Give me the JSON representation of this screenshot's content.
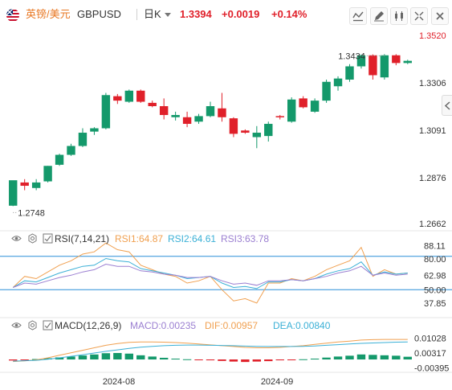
{
  "header": {
    "symbol_name": "英镑/美元",
    "symbol_code": "GBPUSD",
    "period": "日K",
    "last_price": "1.3394",
    "change": "+0.0019",
    "change_pct": "+0.14%"
  },
  "toolbar": {
    "icons": [
      "compare-icon",
      "draw-icon",
      "indicator-icon",
      "fullscreen-icon",
      "close-icon"
    ]
  },
  "price_axis": {
    "labels": [
      "1.3520",
      "1.3306",
      "1.3091",
      "1.2876",
      "1.2662"
    ],
    "high_label": "1.3434",
    "low_label": "1.2748"
  },
  "time_axis": {
    "labels": [
      "2024-08",
      "2024-09"
    ]
  },
  "rsi": {
    "title": "RSI(7,14,21)",
    "rsi1": "RSI1:64.87",
    "rsi2": "RSI2:64.61",
    "rsi3": "RSI3:63.78",
    "axis_labels": [
      "88.11",
      "80.00",
      "62.98",
      "50.00",
      "37.85"
    ]
  },
  "macd": {
    "title": "MACD(12,26,9)",
    "macd": "MACD:0.00235",
    "dif": "DIF:0.00957",
    "dea": "DEA:0.00840",
    "axis_labels": [
      "0.01028",
      "0.00317",
      "-0.00395"
    ]
  },
  "colors": {
    "up": "#e0202a",
    "down": "#14996b",
    "accent": "#e87722",
    "rsi1": "#f0a050",
    "rsi2": "#3bb0d6",
    "rsi3": "#9b7fd1",
    "dif": "#f0a050",
    "dea": "#3bb0d6",
    "ref_line": "#2a8fd8"
  },
  "chart_data": {
    "type": "candlestick",
    "ylim": [
      1.2662,
      1.352
    ],
    "candles": [
      {
        "o": 1.275,
        "h": 1.28,
        "l": 1.2748,
        "c": 1.2865,
        "dir": "down"
      },
      {
        "o": 1.284,
        "h": 1.287,
        "l": 1.282,
        "c": 1.2855,
        "dir": "up"
      },
      {
        "o": 1.2855,
        "h": 1.287,
        "l": 1.282,
        "c": 1.283,
        "dir": "down"
      },
      {
        "o": 1.286,
        "h": 1.293,
        "l": 1.2855,
        "c": 1.293,
        "dir": "down"
      },
      {
        "o": 1.2935,
        "h": 1.2985,
        "l": 1.293,
        "c": 1.298,
        "dir": "down"
      },
      {
        "o": 1.298,
        "h": 1.303,
        "l": 1.2975,
        "c": 1.302,
        "dir": "down"
      },
      {
        "o": 1.302,
        "h": 1.31,
        "l": 1.3015,
        "c": 1.308,
        "dir": "down"
      },
      {
        "o": 1.3085,
        "h": 1.3105,
        "l": 1.307,
        "c": 1.31,
        "dir": "down"
      },
      {
        "o": 1.31,
        "h": 1.326,
        "l": 1.3095,
        "c": 1.325,
        "dir": "down"
      },
      {
        "o": 1.3245,
        "h": 1.3255,
        "l": 1.321,
        "c": 1.3225,
        "dir": "up"
      },
      {
        "o": 1.322,
        "h": 1.3275,
        "l": 1.3215,
        "c": 1.327,
        "dir": "down"
      },
      {
        "o": 1.327,
        "h": 1.3275,
        "l": 1.3215,
        "c": 1.322,
        "dir": "up"
      },
      {
        "o": 1.3215,
        "h": 1.3225,
        "l": 1.3195,
        "c": 1.32,
        "dir": "up"
      },
      {
        "o": 1.32,
        "h": 1.3235,
        "l": 1.314,
        "c": 1.316,
        "dir": "up"
      },
      {
        "o": 1.316,
        "h": 1.3175,
        "l": 1.3135,
        "c": 1.315,
        "dir": "down"
      },
      {
        "o": 1.315,
        "h": 1.3175,
        "l": 1.3105,
        "c": 1.312,
        "dir": "up"
      },
      {
        "o": 1.313,
        "h": 1.3165,
        "l": 1.312,
        "c": 1.3155,
        "dir": "down"
      },
      {
        "o": 1.3155,
        "h": 1.322,
        "l": 1.315,
        "c": 1.32,
        "dir": "down"
      },
      {
        "o": 1.319,
        "h": 1.326,
        "l": 1.313,
        "c": 1.315,
        "dir": "up"
      },
      {
        "o": 1.3145,
        "h": 1.315,
        "l": 1.306,
        "c": 1.3075,
        "dir": "up"
      },
      {
        "o": 1.308,
        "h": 1.3095,
        "l": 1.3075,
        "c": 1.309,
        "dir": "up"
      },
      {
        "o": 1.308,
        "h": 1.311,
        "l": 1.301,
        "c": 1.306,
        "dir": "down"
      },
      {
        "o": 1.3065,
        "h": 1.313,
        "l": 1.304,
        "c": 1.312,
        "dir": "down"
      },
      {
        "o": 1.315,
        "h": 1.316,
        "l": 1.314,
        "c": 1.3155,
        "dir": "up"
      },
      {
        "o": 1.313,
        "h": 1.324,
        "l": 1.3125,
        "c": 1.323,
        "dir": "down"
      },
      {
        "o": 1.3235,
        "h": 1.3245,
        "l": 1.319,
        "c": 1.3195,
        "dir": "up"
      },
      {
        "o": 1.3175,
        "h": 1.3235,
        "l": 1.317,
        "c": 1.3225,
        "dir": "down"
      },
      {
        "o": 1.3225,
        "h": 1.332,
        "l": 1.3215,
        "c": 1.331,
        "dir": "down"
      },
      {
        "o": 1.329,
        "h": 1.3335,
        "l": 1.327,
        "c": 1.3325,
        "dir": "down"
      },
      {
        "o": 1.332,
        "h": 1.339,
        "l": 1.331,
        "c": 1.338,
        "dir": "down"
      },
      {
        "o": 1.338,
        "h": 1.3434,
        "l": 1.337,
        "c": 1.343,
        "dir": "down"
      },
      {
        "o": 1.343,
        "h": 1.3434,
        "l": 1.332,
        "c": 1.334,
        "dir": "up"
      },
      {
        "o": 1.333,
        "h": 1.3435,
        "l": 1.332,
        "c": 1.343,
        "dir": "down"
      },
      {
        "o": 1.343,
        "h": 1.3435,
        "l": 1.3385,
        "c": 1.3395,
        "dir": "up"
      },
      {
        "o": 1.3395,
        "h": 1.341,
        "l": 1.339,
        "c": 1.3405,
        "dir": "down"
      }
    ],
    "rsi_range": [
      30,
      95
    ],
    "rsi1": [
      52,
      62,
      60,
      66,
      72,
      76,
      82,
      84,
      92,
      86,
      84,
      72,
      68,
      64,
      62,
      56,
      58,
      62,
      50,
      40,
      42,
      38,
      56,
      56,
      60,
      58,
      62,
      68,
      72,
      76,
      88,
      62,
      68,
      64,
      65
    ],
    "rsi2": [
      52,
      58,
      57,
      61,
      65,
      68,
      71,
      72,
      78,
      76,
      75,
      69,
      67,
      65,
      63,
      60,
      61,
      62,
      56,
      52,
      53,
      51,
      57,
      57,
      59,
      58,
      60,
      64,
      67,
      69,
      75,
      63,
      66,
      64,
      65
    ],
    "rsi3": [
      52,
      56,
      55,
      58,
      61,
      63,
      66,
      68,
      73,
      71,
      71,
      67,
      66,
      64,
      63,
      61,
      61,
      62,
      58,
      55,
      56,
      54,
      58,
      58,
      59,
      58,
      60,
      62,
      65,
      67,
      71,
      63,
      65,
      63,
      64
    ],
    "macd_range": [
      -0.005,
      0.0135
    ],
    "macd_hist": [
      -0.0005,
      -0.0003,
      0.0002,
      0.0006,
      0.001,
      0.0014,
      0.0019,
      0.0024,
      0.003,
      0.0031,
      0.0028,
      0.002,
      0.0014,
      0.0008,
      0.0004,
      0.0001,
      -0.0001,
      -0.0004,
      -0.0007,
      -0.001,
      -0.0012,
      -0.001,
      -0.0008,
      -0.0004,
      -0.0002,
      0.0001,
      0.0004,
      0.0009,
      0.0014,
      0.0018,
      0.0024,
      0.0022,
      0.002,
      0.0018,
      0.0013
    ],
    "dif": [
      -0.001,
      -0.0007,
      -0.0002,
      0.0008,
      0.002,
      0.0032,
      0.0044,
      0.0056,
      0.0068,
      0.0076,
      0.0082,
      0.0084,
      0.0084,
      0.0083,
      0.0081,
      0.0078,
      0.0074,
      0.007,
      0.0066,
      0.0062,
      0.0058,
      0.0056,
      0.0056,
      0.0058,
      0.0062,
      0.0066,
      0.0072,
      0.0078,
      0.0084,
      0.0088,
      0.0093,
      0.0095,
      0.0096,
      0.0096,
      0.0096
    ],
    "dea": [
      -0.0008,
      -0.0006,
      -0.0004,
      0.0001,
      0.0008,
      0.0015,
      0.0023,
      0.0031,
      0.0039,
      0.0046,
      0.0053,
      0.0059,
      0.0063,
      0.0066,
      0.0068,
      0.0069,
      0.0069,
      0.0068,
      0.0067,
      0.0066,
      0.0064,
      0.0063,
      0.0062,
      0.0062,
      0.0062,
      0.0063,
      0.0065,
      0.0068,
      0.0071,
      0.0074,
      0.0077,
      0.0079,
      0.0081,
      0.0083,
      0.0084
    ]
  }
}
